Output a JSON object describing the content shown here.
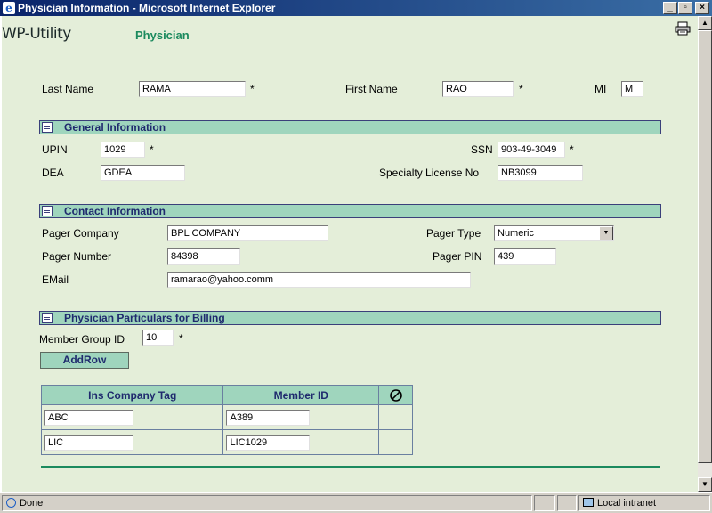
{
  "window": {
    "title": "Physician Information - Microsoft Internet Explorer",
    "buttons": {
      "minimize": "_",
      "maximize": "▫",
      "close": "×"
    }
  },
  "header": {
    "brand": "WP-Utility",
    "module": "Physician"
  },
  "name": {
    "last_name_label": "Last Name",
    "last_name": "RAMA",
    "first_name_label": "First Name",
    "first_name": "RAO",
    "mi_label": "MI",
    "mi": "M",
    "required_mark": "*"
  },
  "general": {
    "title": "General Information",
    "upin_label": "UPIN",
    "upin": "1029",
    "ssn_label": "SSN",
    "ssn": "903-49-3049",
    "dea_label": "DEA",
    "dea": "GDEA",
    "specialty_label": "Specialty License No",
    "specialty": "NB3099"
  },
  "contact": {
    "title": "Contact Information",
    "pager_company_label": "Pager Company",
    "pager_company": "BPL COMPANY",
    "pager_type_label": "Pager Type",
    "pager_type": "Numeric",
    "pager_number_label": "Pager Number",
    "pager_number": "84398",
    "pager_pin_label": "Pager PIN",
    "pager_pin": "439",
    "email_label": "EMail",
    "email": "ramarao@yahoo.comm"
  },
  "billing": {
    "title": "Physician Particulars for Billing",
    "member_group_label": "Member Group ID",
    "member_group": "10",
    "add_row_label": "AddRow",
    "columns": [
      "Ins Company Tag",
      "Member ID"
    ],
    "rows": [
      {
        "ins_company_tag": "ABC",
        "member_id": "A389"
      },
      {
        "ins_company_tag": "LIC",
        "member_id": "LIC1029"
      }
    ]
  },
  "status": {
    "text": "Done",
    "zone": "Local intranet"
  },
  "colors": {
    "page_bg": "#e4eed9",
    "section_bg": "#9fd5bd",
    "section_text": "#1f2a6e",
    "brand_accent": "#1b8a5e"
  }
}
